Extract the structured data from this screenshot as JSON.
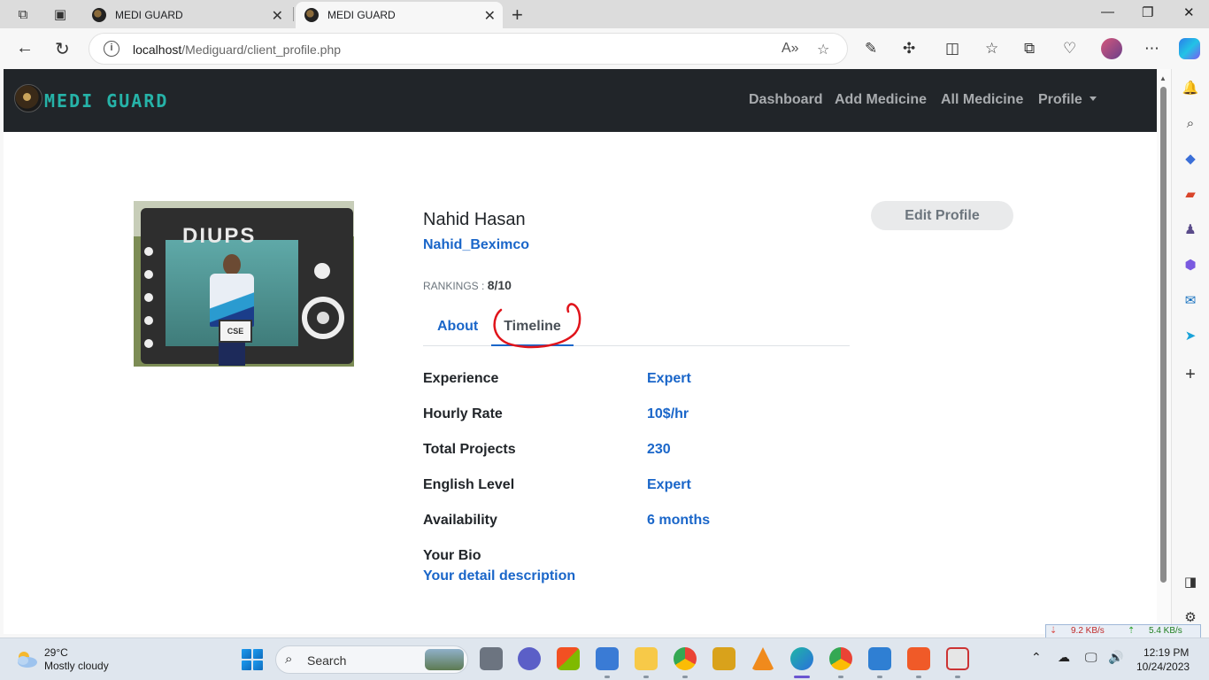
{
  "browser": {
    "tabs": [
      {
        "title": "MEDI GUARD",
        "active": false
      },
      {
        "title": "MEDI GUARD",
        "active": true
      }
    ],
    "address": {
      "host": "localhost",
      "path": "/Mediguard/client_profile.php"
    }
  },
  "site": {
    "brand": "MEDI GUARD",
    "nav": [
      "Dashboard",
      "Add Medicine",
      "All Medicine",
      "Profile"
    ]
  },
  "profile": {
    "photo_sign": "CSE",
    "photo_banner": "DIUPS",
    "name": "Nahid Hasan",
    "username": "Nahid_Beximco",
    "rankings_label": "RANKINGS : ",
    "rankings_value": "8/10",
    "edit_button": "Edit Profile",
    "tabs": [
      {
        "label": "About",
        "active": false
      },
      {
        "label": "Timeline",
        "active": true
      }
    ],
    "details": [
      {
        "label": "Experience",
        "value": "Expert"
      },
      {
        "label": "Hourly Rate",
        "value": "10$/hr"
      },
      {
        "label": "Total Projects",
        "value": "230"
      },
      {
        "label": "English Level",
        "value": "Expert"
      },
      {
        "label": "Availability",
        "value": "6 months"
      }
    ],
    "bio_label": "Your Bio",
    "bio_value": "Your detail description"
  },
  "netmeter": {
    "down": "9.2 KB/s",
    "up": "5.4 KB/s"
  },
  "taskbar": {
    "weather_temp": "29°C",
    "weather_desc": "Mostly cloudy",
    "search_label": "Search",
    "time": "12:19 PM",
    "date": "10/24/2023"
  },
  "colors": {
    "navbar_bg": "#212529",
    "brand_teal": "#26b3a8",
    "link_blue": "#1a66c9",
    "annotation_red": "#e0141b"
  }
}
